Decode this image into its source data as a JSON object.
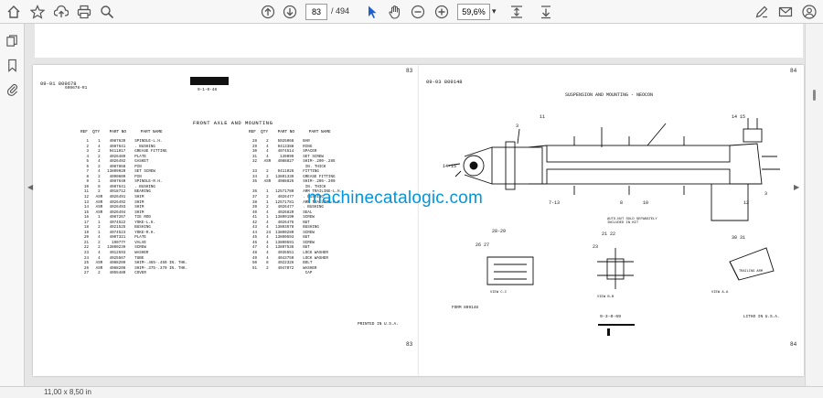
{
  "toolbar": {
    "page_current": "83",
    "page_total": "/ 494",
    "zoom": "59,6%",
    "zoom_caret": "▾"
  },
  "status": {
    "page_size": "11,00 x 8,50 in"
  },
  "watermark": "machinecatalogic.com",
  "left_page": {
    "page_number_top": "83",
    "page_number_bottom": "83",
    "header_code": "09-01  809678",
    "header_sub": "609678-R1",
    "header_mid": "9-1-0-48",
    "title": "FRONT AXLE AND MOUNTING",
    "col_heads_a": "REF  QTY    PART NO      PART NAME",
    "col_heads_b": "REF  QTY    PART NO      PART NAME",
    "list_a": " 1    1    4087639    SPINDLE-L.H.\n 2    4    4087641    . BUSHING\n 3    2    9411017    GREASE FITTING\n 4    2    4026489    PLATE\n 5    4    4026492    GASKET\n 6    2    4087868    PIN\n 7    4   13809020    SET SCREW\n 8    2    4090609    PIN\n 9    1    4087640    SPINDLE-R.H.\n10    8    4087641    . BUSHING\n11    2    4018712    BEARING\n12   ASR   4026491    SHIM\n13   ASR   4026492    SHIM\n14   ASR   4026493    SHIM\n15   ASR   4026494    SHIM\n16    1    4087267    TIE ROD\n17    1    4074522    YOKE-L.H.\n18    2    4021525    BUSHING\n19    1    4074523    YOKE-R.H.\n20    4    4007321    PLATE\n21    2     19077Y    VALVE\n22    2   13800239    SCREW\n23    4    4012593    WASHER\n24    4    4025567    TUBE\n25   ASR   4088209    SHIM-.465-.460 IN. THK.\n26   ASR   4088208    SHIM-.375-.370 IN. THK.\n27    2    4055480    COVER",
    "list_b": "28    2    5025068    BAR\n29    4    9413388    RING\n30    4    4074514    SPACER\n31    4     139099    SET SCREW\n32   ASR   4088827    SHIM-.290-.285\n                       IN. THICK\n33    2    9411026    FITTING\n34    2   13801339    GREASE FITTING\n35   ASR   4088826    SHIM-.205-.200\n                       IN. THICK\n36    1   12571780    ARM TRAILING-L.H.\n37    2    4026477    . BUSHING\n38    1   12571781    ARM TRAILING-R.H.\n39    2    4026477    . BUSHING\n40    4    4026820    SEAL\n41    1   13800190    SCREW\n42    4    4026476    NUT\n43    4   13803678    BUSHING\n44    24  13800280    SCREW\n45    4   13800593    NUT\n46    4   13800591    SCREW\n47    4   13807536    NUT\n48    4    4035551    LOCK WASHER\n49    4    4043750    LOCK WASHER\n50    8    4022326    BOLT\n51    2    4047072    WASHER\n                       CAP",
    "printed": "PRINTED IN U.S.A."
  },
  "right_page": {
    "page_number_top": "84",
    "page_number_bottom": "84",
    "header_code": "09-03  809148",
    "title": "SUSPENSION AND MOUNTING - NEOCON",
    "note": "AUTO-NUT SOLD SEPARATELY INCLUDED IN KIT",
    "view_a": "VIEW C-C",
    "view_b": "VIEW B-B",
    "view_c": "VIEW A-A",
    "trailing_arm": "TRAILING ARM",
    "form": "FORM 809148",
    "code": "9-3-0-69",
    "litho": "LITHO IN U.S.A."
  }
}
